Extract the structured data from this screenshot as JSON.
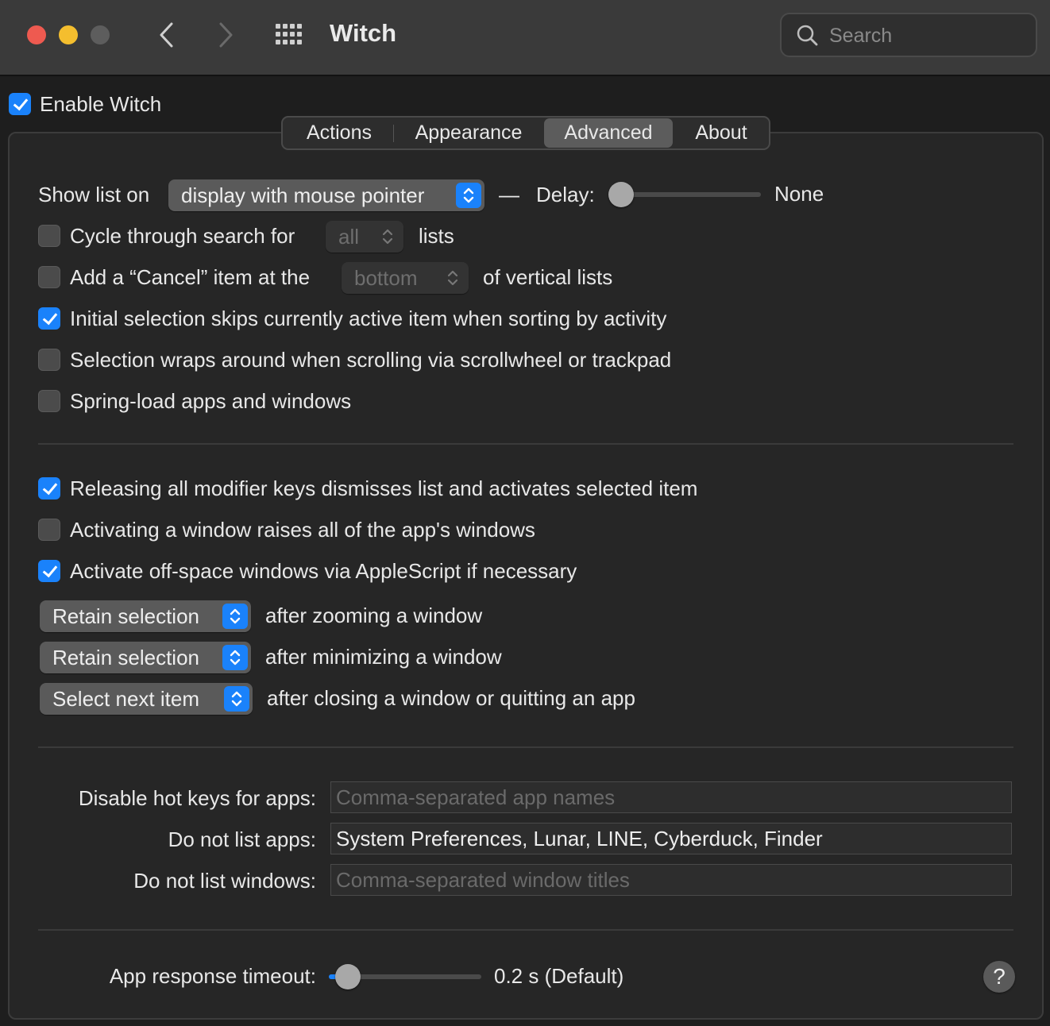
{
  "window": {
    "title": "Witch",
    "search_placeholder": "Search"
  },
  "enable": {
    "label": "Enable Witch",
    "checked": true
  },
  "tabs": [
    {
      "label": "Actions",
      "selected": false
    },
    {
      "label": "Appearance",
      "selected": false
    },
    {
      "label": "Advanced",
      "selected": true
    },
    {
      "label": "About",
      "selected": false
    }
  ],
  "show_list": {
    "label": "Show list on",
    "popup_value": "display with mouse pointer",
    "dash": "—",
    "delay_label": "Delay:",
    "delay_value": "None"
  },
  "options": {
    "cycle": {
      "label_before": "Cycle through search for",
      "popup_value": "all",
      "label_after": "lists",
      "checked": false
    },
    "cancel": {
      "label_before": "Add a “Cancel” item at the",
      "popup_value": "bottom",
      "label_after": "of vertical lists",
      "checked": false
    },
    "initial_skip": {
      "label": "Initial selection skips currently active item when sorting by activity",
      "checked": true
    },
    "wraps": {
      "label": "Selection wraps around when scrolling via scrollwheel or trackpad",
      "checked": false
    },
    "spring": {
      "label": "Spring-load apps and windows",
      "checked": false
    },
    "releasing": {
      "label": "Releasing all modifier keys dismisses list and activates selected item",
      "checked": true
    },
    "raises": {
      "label": "Activating a window raises all of the app's windows",
      "checked": false
    },
    "offspace": {
      "label": "Activate off-space windows via AppleScript if necessary",
      "checked": true
    }
  },
  "behaviors": [
    {
      "popup_value": "Retain selection",
      "label": "after zooming a window"
    },
    {
      "popup_value": "Retain selection",
      "label": "after minimizing a window"
    },
    {
      "popup_value": "Select next item",
      "label": "after closing a window or quitting an app"
    }
  ],
  "fields": {
    "disable_hotkeys": {
      "label": "Disable hot keys for apps:",
      "value": "",
      "placeholder": "Comma-separated app names"
    },
    "do_not_list_apps": {
      "label": "Do not list apps:",
      "value": "System Preferences, Lunar, LINE, Cyberduck, Finder",
      "placeholder": ""
    },
    "do_not_list_windows": {
      "label": "Do not list windows:",
      "value": "",
      "placeholder": "Comma-separated window titles"
    }
  },
  "timeout": {
    "label": "App response timeout:",
    "value": "0.2 s (Default)"
  },
  "help": {
    "label": "?"
  },
  "colors": {
    "accent": "#1a82fb",
    "red": "#ee5a50",
    "yellow": "#f4be2e"
  }
}
